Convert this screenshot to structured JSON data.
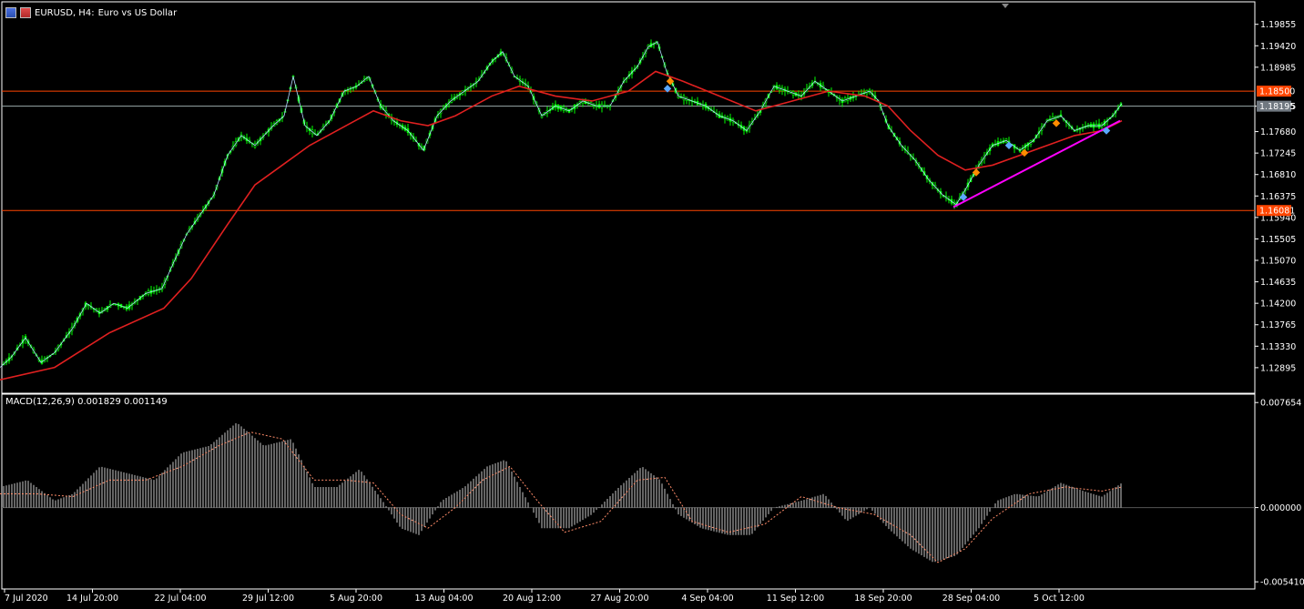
{
  "header": {
    "symbol": "EURUSD, H4:",
    "description": "Euro vs US Dollar",
    "flag_icon_1": "price-chart-icon",
    "flag_icon_2": "flag-icon"
  },
  "macd_label": "MACD(12,26,9) 0.001829 0.001149",
  "colors": {
    "background": "#000000",
    "grid": "#ffffff",
    "candle": "#00ff00",
    "ma_fast": "#b0d8ff",
    "ma_slow": "#e02020",
    "hline": "#ff4500",
    "trendline": "#ff00ff",
    "macd_hist": "#c8c8c8",
    "macd_signal": "#ff8c69"
  },
  "price_axis": {
    "ticks": [
      "1.19855",
      "1.19420",
      "1.18985",
      "1.18195",
      "1.17680",
      "1.17245",
      "1.16810",
      "1.16375",
      "1.15940",
      "1.15505",
      "1.15070",
      "1.14635",
      "1.14200",
      "1.13765",
      "1.13330",
      "1.12895"
    ],
    "range": [
      1.1245,
      1.202
    ],
    "tag_1": "1.18500",
    "tag_2": "1.18195",
    "tag_3": "1.16081"
  },
  "macd_axis": {
    "ticks": [
      "0.007654",
      "0.000000",
      "-0.005410"
    ],
    "range": [
      -0.0056,
      0.0078
    ]
  },
  "time_axis": {
    "labels": [
      "7 Jul 2020",
      "14 Jul 20:00",
      "22 Jul 04:00",
      "29 Jul 12:00",
      "5 Aug 20:00",
      "13 Aug 04:00",
      "20 Aug 12:00",
      "27 Aug 20:00",
      "4 Sep 04:00",
      "11 Sep 12:00",
      "18 Sep 20:00",
      "28 Sep 04:00",
      "5 Oct 12:00"
    ]
  },
  "chart_data": {
    "type": "candlestick",
    "symbol": "EURUSD",
    "timeframe": "H4",
    "ylim": [
      1.1245,
      1.202
    ],
    "horizontal_lines": [
      1.185,
      1.18195,
      1.16081
    ],
    "price_path": [
      [
        0,
        1.129
      ],
      [
        12,
        1.131
      ],
      [
        28,
        1.135
      ],
      [
        45,
        1.13
      ],
      [
        60,
        1.132
      ],
      [
        80,
        1.137
      ],
      [
        95,
        1.142
      ],
      [
        110,
        1.14
      ],
      [
        125,
        1.142
      ],
      [
        140,
        1.141
      ],
      [
        160,
        1.144
      ],
      [
        178,
        1.145
      ],
      [
        190,
        1.15
      ],
      [
        205,
        1.156
      ],
      [
        220,
        1.16
      ],
      [
        235,
        1.164
      ],
      [
        250,
        1.172
      ],
      [
        265,
        1.176
      ],
      [
        280,
        1.174
      ],
      [
        300,
        1.178
      ],
      [
        312,
        1.18
      ],
      [
        322,
        1.188
      ],
      [
        335,
        1.178
      ],
      [
        348,
        1.176
      ],
      [
        362,
        1.179
      ],
      [
        378,
        1.185
      ],
      [
        392,
        1.186
      ],
      [
        405,
        1.188
      ],
      [
        418,
        1.182
      ],
      [
        432,
        1.179
      ],
      [
        448,
        1.177
      ],
      [
        465,
        1.173
      ],
      [
        480,
        1.18
      ],
      [
        495,
        1.183
      ],
      [
        510,
        1.185
      ],
      [
        525,
        1.187
      ],
      [
        540,
        1.191
      ],
      [
        552,
        1.193
      ],
      [
        565,
        1.188
      ],
      [
        580,
        1.186
      ],
      [
        595,
        1.18
      ],
      [
        610,
        1.182
      ],
      [
        625,
        1.181
      ],
      [
        640,
        1.183
      ],
      [
        655,
        1.182
      ],
      [
        670,
        1.182
      ],
      [
        685,
        1.187
      ],
      [
        700,
        1.19
      ],
      [
        712,
        1.194
      ],
      [
        722,
        1.195
      ],
      [
        732,
        1.189
      ],
      [
        745,
        1.184
      ],
      [
        760,
        1.183
      ],
      [
        775,
        1.182
      ],
      [
        790,
        1.18
      ],
      [
        805,
        1.179
      ],
      [
        820,
        1.177
      ],
      [
        835,
        1.181
      ],
      [
        850,
        1.186
      ],
      [
        865,
        1.185
      ],
      [
        880,
        1.184
      ],
      [
        895,
        1.187
      ],
      [
        910,
        1.185
      ],
      [
        925,
        1.183
      ],
      [
        940,
        1.184
      ],
      [
        955,
        1.185
      ],
      [
        965,
        1.183
      ],
      [
        975,
        1.178
      ],
      [
        990,
        1.174
      ],
      [
        1005,
        1.171
      ],
      [
        1020,
        1.167
      ],
      [
        1035,
        1.164
      ],
      [
        1050,
        1.162
      ],
      [
        1060,
        1.165
      ],
      [
        1075,
        1.17
      ],
      [
        1090,
        1.174
      ],
      [
        1105,
        1.175
      ],
      [
        1120,
        1.173
      ],
      [
        1135,
        1.175
      ],
      [
        1150,
        1.179
      ],
      [
        1165,
        1.18
      ],
      [
        1180,
        1.177
      ],
      [
        1195,
        1.178
      ],
      [
        1210,
        1.178
      ],
      [
        1222,
        1.18
      ],
      [
        1232,
        1.1825
      ]
    ],
    "ma_slow_path": [
      [
        0,
        1.1265
      ],
      [
        60,
        1.129
      ],
      [
        120,
        1.136
      ],
      [
        180,
        1.141
      ],
      [
        210,
        1.147
      ],
      [
        250,
        1.158
      ],
      [
        280,
        1.166
      ],
      [
        310,
        1.17
      ],
      [
        340,
        1.174
      ],
      [
        380,
        1.178
      ],
      [
        410,
        1.181
      ],
      [
        440,
        1.179
      ],
      [
        470,
        1.178
      ],
      [
        500,
        1.18
      ],
      [
        540,
        1.184
      ],
      [
        570,
        1.186
      ],
      [
        610,
        1.184
      ],
      [
        650,
        1.183
      ],
      [
        690,
        1.185
      ],
      [
        720,
        1.189
      ],
      [
        750,
        1.187
      ],
      [
        790,
        1.184
      ],
      [
        830,
        1.181
      ],
      [
        870,
        1.183
      ],
      [
        910,
        1.185
      ],
      [
        950,
        1.184
      ],
      [
        975,
        1.182
      ],
      [
        1000,
        1.177
      ],
      [
        1030,
        1.172
      ],
      [
        1060,
        1.169
      ],
      [
        1090,
        1.17
      ],
      [
        1120,
        1.172
      ],
      [
        1150,
        1.174
      ],
      [
        1180,
        1.176
      ],
      [
        1210,
        1.177
      ],
      [
        1232,
        1.179
      ]
    ],
    "trendline": [
      [
        1047,
        1.1615
      ],
      [
        1230,
        1.179
      ]
    ],
    "macd_histogram_path": [
      [
        0,
        0.0015
      ],
      [
        30,
        0.002
      ],
      [
        60,
        0.0005
      ],
      [
        80,
        0.001
      ],
      [
        110,
        0.003
      ],
      [
        140,
        0.0025
      ],
      [
        170,
        0.002
      ],
      [
        200,
        0.004
      ],
      [
        230,
        0.0045
      ],
      [
        260,
        0.0062
      ],
      [
        290,
        0.0045
      ],
      [
        320,
        0.005
      ],
      [
        345,
        0.0015
      ],
      [
        370,
        0.0015
      ],
      [
        395,
        0.0028
      ],
      [
        420,
        0.0005
      ],
      [
        440,
        -0.0015
      ],
      [
        460,
        -0.002
      ],
      [
        485,
        0.0005
      ],
      [
        510,
        0.0015
      ],
      [
        535,
        0.003
      ],
      [
        555,
        0.0035
      ],
      [
        575,
        0.001
      ],
      [
        595,
        -0.0015
      ],
      [
        625,
        -0.0015
      ],
      [
        650,
        -0.0005
      ],
      [
        680,
        0.0015
      ],
      [
        705,
        0.003
      ],
      [
        725,
        0.002
      ],
      [
        745,
        -0.0005
      ],
      [
        770,
        -0.0015
      ],
      [
        800,
        -0.002
      ],
      [
        825,
        -0.002
      ],
      [
        850,
        0.0
      ],
      [
        880,
        0.0005
      ],
      [
        905,
        0.001
      ],
      [
        930,
        -0.001
      ],
      [
        955,
        0.0
      ],
      [
        975,
        -0.0015
      ],
      [
        1000,
        -0.003
      ],
      [
        1025,
        -0.004
      ],
      [
        1050,
        -0.0035
      ],
      [
        1075,
        -0.0015
      ],
      [
        1095,
        0.0005
      ],
      [
        1115,
        0.001
      ],
      [
        1140,
        0.0008
      ],
      [
        1165,
        0.0018
      ],
      [
        1190,
        0.0012
      ],
      [
        1210,
        0.0008
      ],
      [
        1232,
        0.0018
      ]
    ],
    "macd_signal_path": [
      [
        0,
        0.001
      ],
      [
        40,
        0.001
      ],
      [
        80,
        0.0008
      ],
      [
        120,
        0.002
      ],
      [
        160,
        0.002
      ],
      [
        200,
        0.003
      ],
      [
        240,
        0.0045
      ],
      [
        275,
        0.0055
      ],
      [
        310,
        0.005
      ],
      [
        345,
        0.002
      ],
      [
        380,
        0.002
      ],
      [
        410,
        0.0018
      ],
      [
        440,
        -0.0005
      ],
      [
        470,
        -0.0015
      ],
      [
        500,
        0.0
      ],
      [
        530,
        0.002
      ],
      [
        560,
        0.003
      ],
      [
        590,
        0.0005
      ],
      [
        620,
        -0.0018
      ],
      [
        660,
        -0.001
      ],
      [
        700,
        0.002
      ],
      [
        730,
        0.0022
      ],
      [
        760,
        -0.001
      ],
      [
        800,
        -0.0018
      ],
      [
        840,
        -0.0012
      ],
      [
        880,
        0.0008
      ],
      [
        920,
        0.0
      ],
      [
        960,
        -0.0005
      ],
      [
        1000,
        -0.002
      ],
      [
        1030,
        -0.004
      ],
      [
        1060,
        -0.003
      ],
      [
        1090,
        -0.0008
      ],
      [
        1130,
        0.001
      ],
      [
        1170,
        0.0015
      ],
      [
        1210,
        0.0012
      ],
      [
        1232,
        0.0015
      ]
    ]
  }
}
